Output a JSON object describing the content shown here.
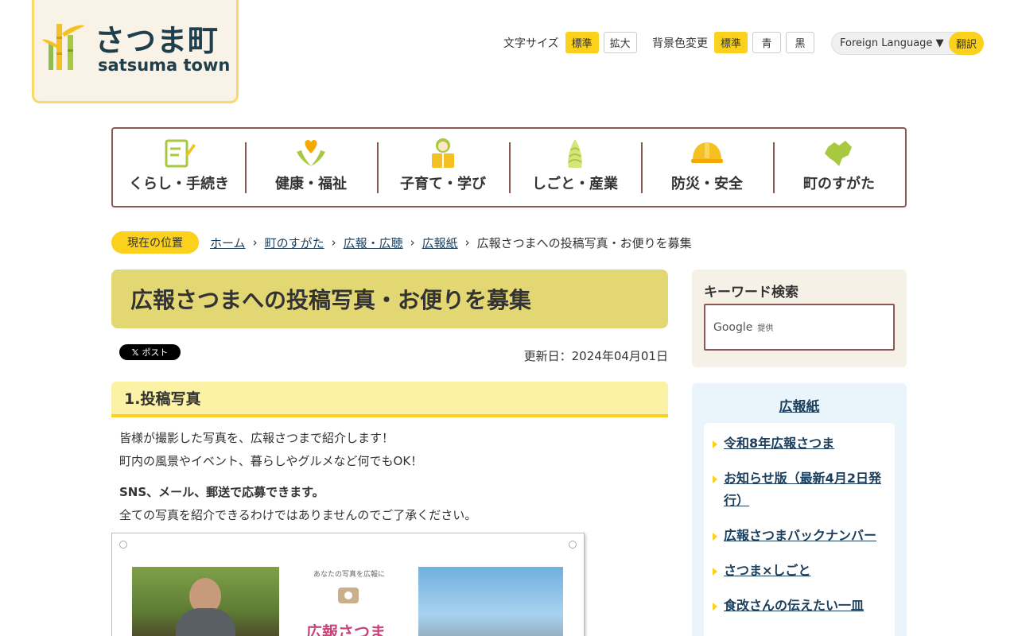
{
  "logo": {
    "jp": "さつま町",
    "en": "satsuma town"
  },
  "font_size": {
    "label": "文字サイズ",
    "standard": "標準",
    "large": "拡大"
  },
  "bg_color": {
    "label": "背景色変更",
    "standard": "標準",
    "blue": "青",
    "black": "黒"
  },
  "language": {
    "select": "Foreign Language",
    "translate": "翻訳"
  },
  "gnav": [
    {
      "label": "くらし・手続き",
      "icon": "pencil-note-icon"
    },
    {
      "label": "健康・福祉",
      "icon": "heart-hands-icon"
    },
    {
      "label": "子育て・学び",
      "icon": "child-book-icon"
    },
    {
      "label": "しごと・産業",
      "icon": "bamboo-shoot-icon"
    },
    {
      "label": "防災・安全",
      "icon": "helmet-icon"
    },
    {
      "label": "町のすがた",
      "icon": "town-map-icon"
    }
  ],
  "breadcrumb": {
    "here": "現在の位置",
    "items": [
      "ホーム",
      "町のすがた",
      "広報・広聴",
      "広報紙"
    ],
    "current": "広報さつまへの投稿写真・お便りを募集"
  },
  "page_title": "広報さつまへの投稿写真・お便りを募集",
  "post_button": "ポスト",
  "updated": "更新日：2024年04月01日",
  "section1": {
    "heading": "1.投稿写真",
    "line1": "皆様が撮影した写真を、広報さつまで紹介します！",
    "line2": "町内の風景やイベント、暮らしやグルメなど何でもOK！",
    "bold": "SNS、メール、郵送で応募できます。",
    "line3": "全ての写真を紹介できるわけではありませんのでご了承ください。"
  },
  "poster": {
    "caption": "あなたの写真を広報に",
    "brand": "広報さつま"
  },
  "search": {
    "title": "キーワード検索",
    "google": "Google",
    "provided": "提供"
  },
  "sidebar": {
    "title": "広報紙",
    "items": [
      "令和8年広報さつま",
      "お知らせ版（最新4月2日発行）",
      "広報さつまバックナンバー",
      "さつま×しごと",
      "食改さんの伝えたい一皿"
    ]
  },
  "colors": {
    "accent_yellow": "#fbd11c",
    "nav_border": "#8a5a52",
    "title_bg": "#e2d772",
    "link": "#1a3e5c"
  }
}
